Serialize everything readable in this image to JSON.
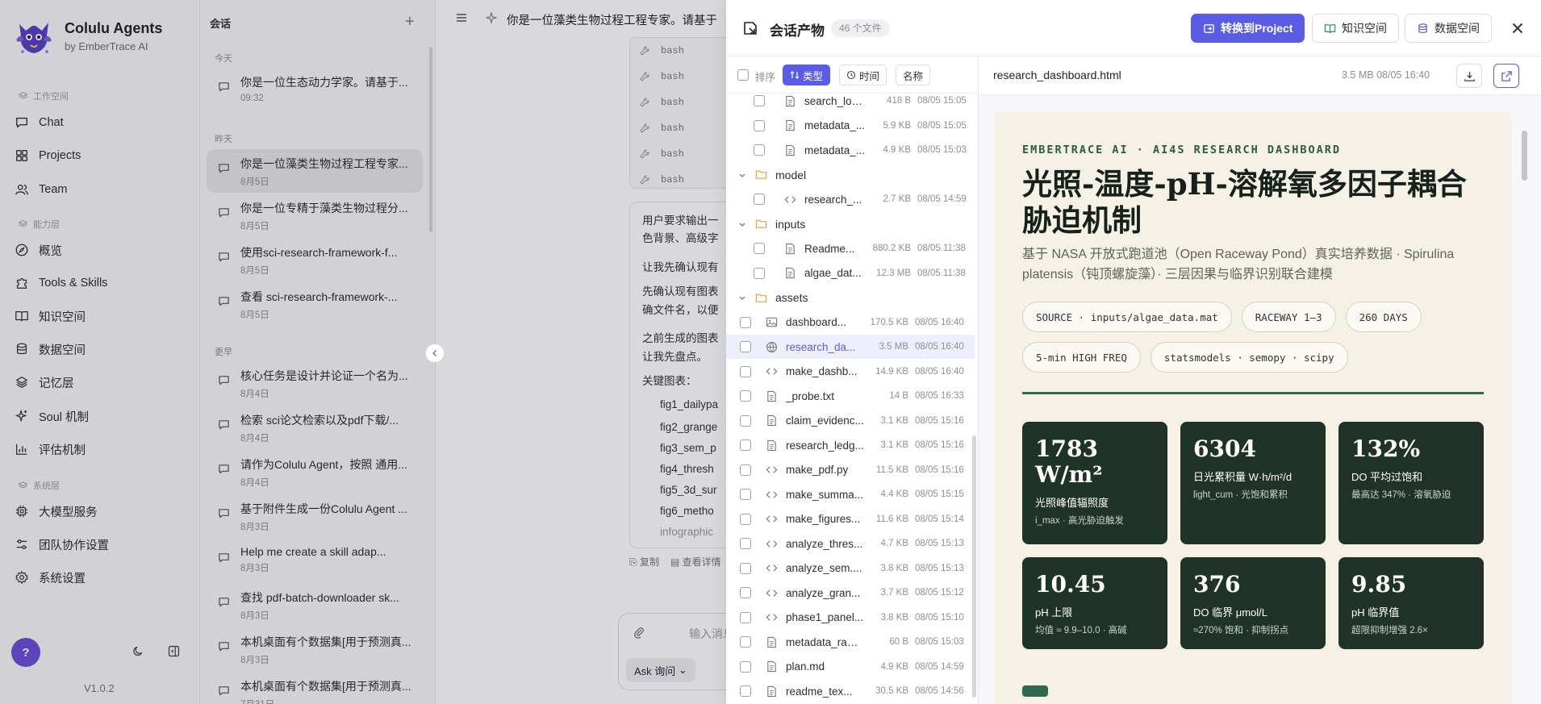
{
  "brand": {
    "name": "Colulu Agents",
    "sub": "by EmberTrace AI"
  },
  "sidebar": {
    "workspace_label": "工作空间",
    "capability_label": "能力层",
    "system_label": "系统层",
    "items": [
      {
        "label": "Chat",
        "icon": "chat-icon"
      },
      {
        "label": "Projects",
        "icon": "grid-icon"
      },
      {
        "label": "Team",
        "icon": "team-icon"
      },
      {
        "label": "概览",
        "icon": "compass-icon"
      },
      {
        "label": "Tools & Skills",
        "icon": "puzzle-icon"
      },
      {
        "label": "知识空间",
        "icon": "book-icon"
      },
      {
        "label": "数据空间",
        "icon": "database-icon"
      },
      {
        "label": "记忆层",
        "icon": "layers-icon"
      },
      {
        "label": "Soul 机制",
        "icon": "sparkle-icon"
      },
      {
        "label": "评估机制",
        "icon": "chart-icon"
      },
      {
        "label": "大模型服务",
        "icon": "chip-icon"
      },
      {
        "label": "团队协作设置",
        "icon": "sliders-icon"
      },
      {
        "label": "系统设置",
        "icon": "gear-icon"
      }
    ],
    "help": "?",
    "version": "V1.0.2"
  },
  "convlist": {
    "title": "会话",
    "groups": {
      "today": "今天",
      "yesterday": "昨天",
      "earlier": "更早"
    },
    "today": [
      {
        "title": "你是一位生态动力学家。请基于...",
        "date": "09:32"
      }
    ],
    "yesterday": [
      {
        "title": "你是一位藻类生物过程工程专家...",
        "date": "8月5日"
      },
      {
        "title": "你是一位专精于藻类生物过程分...",
        "date": "8月5日"
      },
      {
        "title": "使用sci-research-framework-f...",
        "date": "8月5日"
      },
      {
        "title": "查看 sci-research-framework-...",
        "date": "8月5日"
      }
    ],
    "earlier": [
      {
        "title": "核心任务是设计并论证一个名为...",
        "date": "8月4日"
      },
      {
        "title": "检索 sci论文检索以及pdf下载/...",
        "date": "8月4日"
      },
      {
        "title": "请作为Colulu Agent，按照 通用...",
        "date": "8月4日"
      },
      {
        "title": "基于附件生成一份Colulu Agent ...",
        "date": "8月3日"
      },
      {
        "title": "Help me create a skill adap...",
        "date": "8月3日"
      },
      {
        "title": "查找 pdf-batch-downloader sk...",
        "date": "8月3日"
      },
      {
        "title": "本机桌面有个数据集[用于预测真...",
        "date": "8月3日"
      },
      {
        "title": "本机桌面有个数据集[用于预测真...",
        "date": "7月31日"
      }
    ]
  },
  "chat": {
    "title": "你是一位藻类生物过程工程专家。请基于",
    "tool_rows": [
      "bash",
      "bash",
      "bash",
      "bash",
      "bash",
      "bash"
    ],
    "lines": [
      "用户要求输出一",
      "色背景、高级字",
      "让我先确认现有",
      "先确认现有图表",
      "确文件名，以便",
      "之前生成的图表",
      "让我先盘点。",
      "关键图表："
    ],
    "figs": [
      "fig1_dailypa",
      "fig2_grange",
      "fig3_sem_p",
      "fig4_thresh",
      "fig5_3d_sur",
      "fig6_metho",
      "infographic"
    ],
    "copy": "复制",
    "view_detail": "查看详情",
    "input_placeholder": "输入消息... (",
    "ask_label": "Ask 询问"
  },
  "panel": {
    "title": "会话产物",
    "count": "46 个文件",
    "to_project": "转换到Project",
    "knowledge": "知识空间",
    "data": "数据空间",
    "sort_label": "排序",
    "sort_type": "类型",
    "sort_time": "时间",
    "sort_name": "名称",
    "files": [
      {
        "kind": "file",
        "indent": 2,
        "name": "search_log....",
        "size": "418 B",
        "date": "08/05 15:05",
        "icon": "doc-icon"
      },
      {
        "kind": "file",
        "indent": 2,
        "name": "metadata_...",
        "size": "5.9 KB",
        "date": "08/05 15:05",
        "icon": "doc-icon"
      },
      {
        "kind": "file",
        "indent": 2,
        "name": "metadata_...",
        "size": "4.9 KB",
        "date": "08/05 15:03",
        "icon": "doc-icon"
      },
      {
        "kind": "folder",
        "name": "model"
      },
      {
        "kind": "file",
        "indent": 2,
        "name": "research_...",
        "size": "2.7 KB",
        "date": "08/05 14:59",
        "icon": "code-icon"
      },
      {
        "kind": "folder",
        "name": "inputs"
      },
      {
        "kind": "file",
        "indent": 2,
        "name": "Readme...",
        "size": "880.2 KB",
        "date": "08/05 11:38",
        "icon": "doc-icon"
      },
      {
        "kind": "file",
        "indent": 2,
        "name": "algae_dat...",
        "size": "12.3 MB",
        "date": "08/05 11:38",
        "icon": "doc-icon"
      },
      {
        "kind": "folder",
        "name": "assets"
      },
      {
        "kind": "file",
        "indent": 1,
        "name": "dashboard...",
        "size": "170.5 KB",
        "date": "08/05 16:40",
        "icon": "image-icon"
      },
      {
        "kind": "file",
        "indent": 1,
        "name": "research_da...",
        "size": "3.5 MB",
        "date": "08/05 16:40",
        "icon": "globe-icon",
        "selected": true
      },
      {
        "kind": "file",
        "indent": 1,
        "name": "make_dashb...",
        "size": "14.9 KB",
        "date": "08/05 16:40",
        "icon": "code-icon"
      },
      {
        "kind": "file",
        "indent": 1,
        "name": "_probe.txt",
        "size": "14 B",
        "date": "08/05 16:33",
        "icon": "doc-icon"
      },
      {
        "kind": "file",
        "indent": 1,
        "name": "claim_evidenc...",
        "size": "3.1 KB",
        "date": "08/05 15:16",
        "icon": "doc-icon"
      },
      {
        "kind": "file",
        "indent": 1,
        "name": "research_ledg...",
        "size": "3.1 KB",
        "date": "08/05 15:16",
        "icon": "doc-icon"
      },
      {
        "kind": "file",
        "indent": 1,
        "name": "make_pdf.py",
        "size": "11.5 KB",
        "date": "08/05 15:16",
        "icon": "code-icon"
      },
      {
        "kind": "file",
        "indent": 1,
        "name": "make_summa...",
        "size": "4.4 KB",
        "date": "08/05 15:15",
        "icon": "code-icon"
      },
      {
        "kind": "file",
        "indent": 1,
        "name": "make_figures...",
        "size": "11.6 KB",
        "date": "08/05 15:14",
        "icon": "code-icon"
      },
      {
        "kind": "file",
        "indent": 1,
        "name": "analyze_thres...",
        "size": "4.7 KB",
        "date": "08/05 15:13",
        "icon": "code-icon"
      },
      {
        "kind": "file",
        "indent": 1,
        "name": "analyze_sem....",
        "size": "3.8 KB",
        "date": "08/05 15:13",
        "icon": "code-icon"
      },
      {
        "kind": "file",
        "indent": 1,
        "name": "analyze_gran...",
        "size": "3.7 KB",
        "date": "08/05 15:12",
        "icon": "code-icon"
      },
      {
        "kind": "file",
        "indent": 1,
        "name": "phase1_panel...",
        "size": "3.8 KB",
        "date": "08/05 15:10",
        "icon": "code-icon"
      },
      {
        "kind": "file",
        "indent": 1,
        "name": "metadata_raw....",
        "size": "60 B",
        "date": "08/05 15:03",
        "icon": "doc-icon"
      },
      {
        "kind": "file",
        "indent": 1,
        "name": "plan.md",
        "size": "4.9 KB",
        "date": "08/05 14:59",
        "icon": "doc-icon"
      },
      {
        "kind": "file",
        "indent": 1,
        "name": "readme_tex...",
        "size": "30.5 KB",
        "date": "08/05 14:56",
        "icon": "doc-icon"
      }
    ],
    "preview": {
      "filename": "research_dashboard.html",
      "meta": "3.5 MB  08/05 16:40",
      "kicker": "EMBERTRACE AI · AI4S RESEARCH DASHBOARD",
      "title": "光照-温度-pH-溶解氧多因子耦合胁迫机制",
      "subtitle": "基于 NASA 开放式跑道池（Open Raceway Pond）真实培养数据 · Spirulina platensis（钝顶螺旋藻）· 三层因果与临界识别联合建模",
      "chips": [
        "SOURCE · inputs/algae_data.mat",
        "RACEWAY 1–3",
        "260 DAYS",
        "5-min HIGH FREQ",
        "statsmodels · semopy · scipy"
      ],
      "cards": [
        {
          "value": "1783 W/m²",
          "label": "光照峰值辐照度",
          "note": "i_max · 高光胁迫触发"
        },
        {
          "value": "6304",
          "label": "日光累积量 W·h/m²/d",
          "note": "light_cum · 光饱和累积"
        },
        {
          "value": "132%",
          "label": "DO 平均过饱和",
          "note": "最高达 347% · 溶氧胁迫"
        },
        {
          "value": "10.45",
          "label": "pH 上限",
          "note": "均值 ≈ 9.9–10.0 · 高碱"
        },
        {
          "value": "376",
          "label": "DO 临界 μmol/L",
          "note": "≈270% 饱和 · 抑制拐点"
        },
        {
          "value": "9.85",
          "label": "pH 临界值",
          "note": "超限抑制增强 2.6×"
        }
      ]
    }
  }
}
